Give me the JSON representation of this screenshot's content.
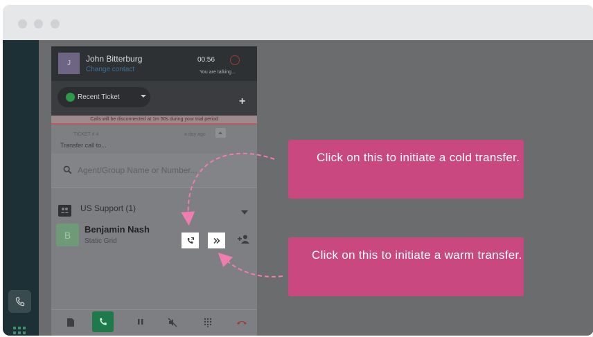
{
  "window": {
    "controls": [
      "close",
      "minimize",
      "zoom"
    ]
  },
  "sidebar": {
    "phone_icon": "phone-icon",
    "apps_icon": "apps-grid-icon"
  },
  "call": {
    "avatar_initial": "J",
    "contact_name": "John Bitterburg",
    "change_contact": "Change contact",
    "timer": "00:56",
    "status": "You are talking...",
    "ticket_selector": "Recent Ticket",
    "warning": "Calls will be disconnected at 1m 50s during your trial period",
    "ticket_label": "TICKET # 4",
    "ticket_age": "a day ago"
  },
  "transfer": {
    "title": "Transfer call to...",
    "search_placeholder": "Agent/Group Name or Number...",
    "group": "US Support (1)",
    "agent": {
      "initial": "B",
      "name": "Benjamin Nash",
      "subtitle": "Static Grid"
    }
  },
  "callouts": {
    "cold": "Click on this to initiate a cold transfer.",
    "warm": "Click on this to initiate a warm transfer."
  },
  "colors": {
    "callout": "#c9487f",
    "arrow": "#f07db0",
    "accept_green": "#1e7a4b"
  }
}
